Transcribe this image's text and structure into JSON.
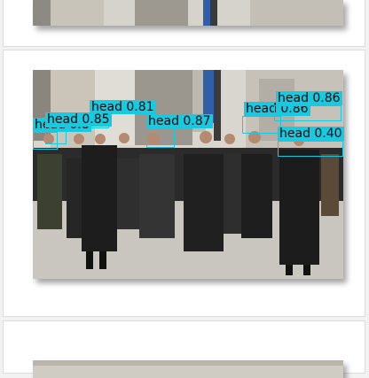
{
  "colors": {
    "detection": "#19c9e0",
    "card": "#ffffff",
    "background": "#f2f2f2"
  },
  "detections": [
    {
      "class": "head",
      "score": "0.81",
      "text": "head 0.81"
    },
    {
      "class": "head",
      "score": "0.85",
      "text": "head 0.85"
    },
    {
      "class": "head",
      "score": "0.8",
      "text": "head 0.8"
    },
    {
      "class": "head",
      "score": "0.87",
      "text": "head 0.87"
    },
    {
      "class": "head",
      "score": "0.86",
      "text": "head 0.86"
    },
    {
      "class": "head",
      "score": "0.86",
      "text": "head 0.86"
    },
    {
      "class": "head",
      "score": "0.40",
      "text": "head 0.40"
    }
  ]
}
